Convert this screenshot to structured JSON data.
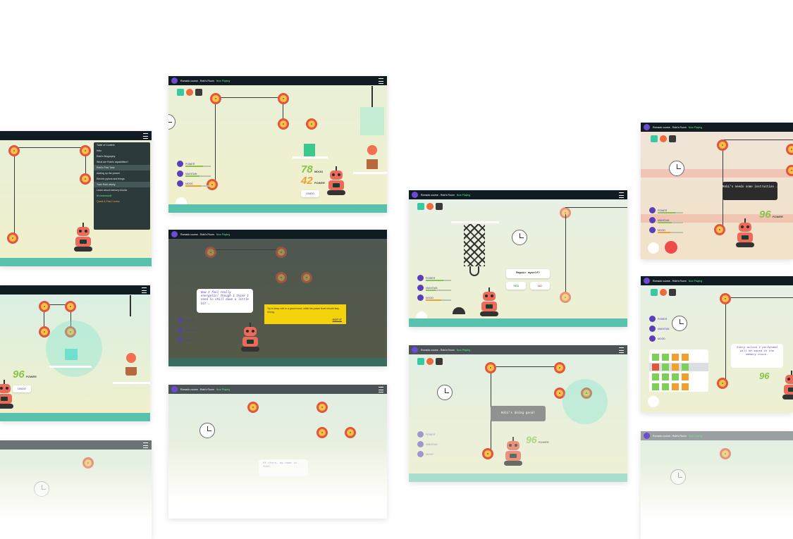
{
  "app": {
    "course_title": "Romado course - Robi's Room",
    "now_playing": "Now Playing"
  },
  "toc": {
    "items": [
      "Table of Content",
      "Intro",
      "Robi's Biography",
      "What are Robi's capabilities?",
      "Robi's First Task",
      "Adding up the power!",
      "Electric pylons and things",
      "Train Robi wisely",
      "Learn about memory blocks",
      "It's teamwork!",
      "Quest & Fast Course"
    ]
  },
  "stats": {
    "power_label": "POWER",
    "maintain_label": "MAINTAIN",
    "mood_label": "MOOD"
  },
  "scores": {
    "mood_value": "78",
    "mood_label": "MOOD",
    "power_value": "42",
    "power_label": "POWER",
    "power_96": "96",
    "power_96_label": "POWER"
  },
  "buttons": {
    "undo": "UNDO",
    "yes": "YES",
    "no": "NO",
    "got_it": "GOT IT"
  },
  "dialogs": {
    "energetic": "Now I feel really energetic! Though I think I need to chill down a little bit …",
    "tip": "Try to keep robi in a good mood, while his power level should stay strong.",
    "repair": "Repair myself?",
    "instruction": "Robi's needs some instruction …",
    "doing_good": "Robi's doing good!",
    "memory": "Every action I performed will be saved in the memory block.",
    "hi": "Hi there, my name is Robi."
  },
  "colors": {
    "topbar": "#111b22",
    "floor": "#58c2ad",
    "robot": "#ec6a5b",
    "wheel": "#f6c24a",
    "accent": "#5a3fb8",
    "power_green": "#8bc34a",
    "tip_yellow": "#f4d20c"
  }
}
